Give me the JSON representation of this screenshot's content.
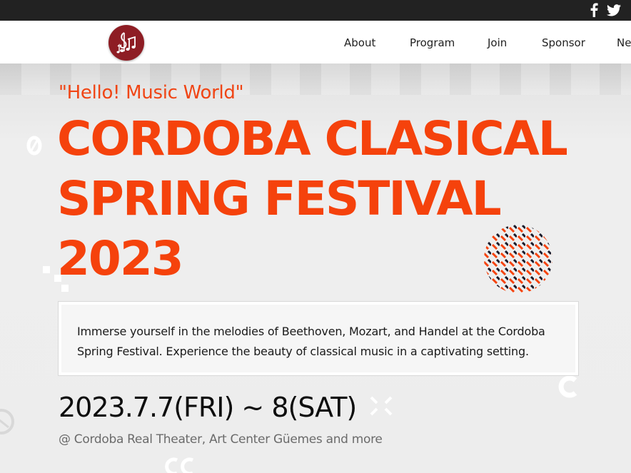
{
  "topbar": {
    "social": [
      {
        "icon": "facebook-icon"
      },
      {
        "icon": "twitter-icon"
      }
    ]
  },
  "nav": {
    "logo_icon": "music-notes-icon",
    "items": [
      {
        "label": "About"
      },
      {
        "label": "Program"
      },
      {
        "label": "Join"
      },
      {
        "label": "Sponsor"
      },
      {
        "label": "Ne"
      }
    ]
  },
  "hero": {
    "subtitle": "\"Hello! Music World\"",
    "title_lines": [
      "CORDOBA CLASICAL",
      "SPRING FESTIVAL",
      "2023"
    ],
    "description": "Immerse yourself in the melodies of Beethoven, Mozart, and Handel at the Cordoba Spring Festival. Experience the beauty of classical music in a captivating setting.",
    "dates": "2023.7.7(FRI) ~ 8(SAT)",
    "venue": "@ Cordoba Real Theater, Art Center Güemes and more"
  },
  "colors": {
    "accent": "#f5420c",
    "logo_bg": "#8e1d24",
    "topbar_bg": "#222222"
  }
}
